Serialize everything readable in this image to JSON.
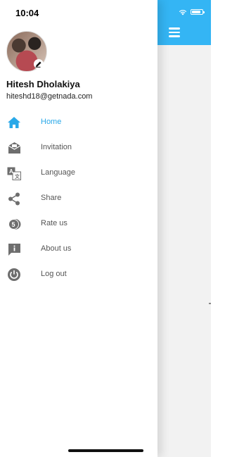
{
  "status_bar": {
    "time": "10:04"
  },
  "user": {
    "name": "Hitesh Dholakiya",
    "email": "hiteshd18@getnada.com"
  },
  "menu": [
    {
      "label": "Home",
      "icon": "home-icon",
      "active": true
    },
    {
      "label": "Invitation",
      "icon": "invitation-icon",
      "active": false
    },
    {
      "label": "Language",
      "icon": "language-icon",
      "active": false
    },
    {
      "label": "Share",
      "icon": "share-icon",
      "active": false
    },
    {
      "label": "Rate us",
      "icon": "rate-icon",
      "active": false
    },
    {
      "label": "About us",
      "icon": "info-icon",
      "active": false
    },
    {
      "label": "Log out",
      "icon": "power-icon",
      "active": false
    }
  ],
  "colors": {
    "accent": "#29a8e8",
    "app_bar": "#34b5f4",
    "icon_gray": "#6e6e6e"
  }
}
